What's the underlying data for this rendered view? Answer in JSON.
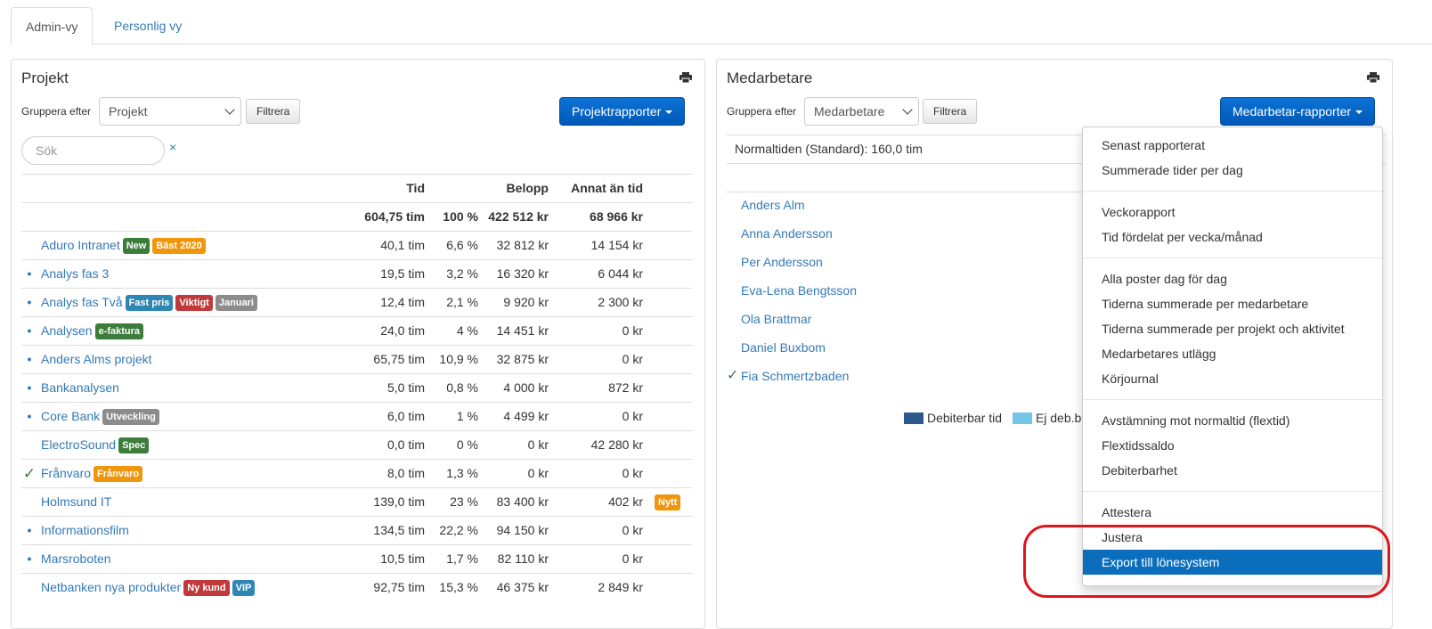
{
  "tabs": {
    "admin": "Admin-vy",
    "personal": "Personlig vy"
  },
  "colors": {
    "link": "#337ab7",
    "primary": "#0b63c8",
    "label_green": "#3c7d3c",
    "label_orange": "#f0960c",
    "label_red": "#c0393b",
    "label_blue": "#2e86b5",
    "label_gray": "#8c8c8c",
    "legend_dark": "#2c5a8f",
    "legend_light": "#74c6e6",
    "highlight": "#e0141d"
  },
  "projekt": {
    "title": "Projekt",
    "print_icon": "print-icon",
    "group_label": "Gruppera efter",
    "group_select": "Projekt",
    "filter_button": "Filtrera",
    "reports_button": "Projektrapporter",
    "search_placeholder": "Sök",
    "search_clear": "×",
    "headers": {
      "tid": "Tid",
      "belopp": "Belopp",
      "annat": "Annat än tid"
    },
    "totals": {
      "tid": "604,75 tim",
      "pct": "100 %",
      "belopp": "422 512 kr",
      "annat": "68 966 kr"
    },
    "rows": [
      {
        "marker": "",
        "name": "Aduro Intranet",
        "labels": [
          {
            "text": "New",
            "color": "green"
          },
          {
            "text": "Bäst 2020",
            "color": "orange"
          }
        ],
        "tid": "40,1 tim",
        "pct": "6,6 %",
        "belopp": "32 812 kr",
        "annat": "14 154 kr"
      },
      {
        "marker": "•",
        "name": "Analys fas 3",
        "labels": [],
        "tid": "19,5 tim",
        "pct": "3,2 %",
        "belopp": "16 320 kr",
        "annat": "6 044 kr"
      },
      {
        "marker": "•",
        "name": "Analys fas Två",
        "labels": [
          {
            "text": "Fast pris",
            "color": "blue"
          },
          {
            "text": "Viktigt",
            "color": "red"
          },
          {
            "text": "Januari",
            "color": "gray"
          }
        ],
        "tid": "12,4 tim",
        "pct": "2,1 %",
        "belopp": "9 920 kr",
        "annat": "2 300 kr"
      },
      {
        "marker": "•",
        "name": "Analysen",
        "labels": [
          {
            "text": "e-faktura",
            "color": "green"
          }
        ],
        "tid": "24,0 tim",
        "pct": "4 %",
        "belopp": "14 451 kr",
        "annat": "0 kr"
      },
      {
        "marker": "•",
        "name": "Anders Alms projekt",
        "labels": [],
        "tid": "65,75 tim",
        "pct": "10,9 %",
        "belopp": "32 875 kr",
        "annat": "0 kr"
      },
      {
        "marker": "•",
        "name": "Bankanalysen",
        "labels": [],
        "tid": "5,0 tim",
        "pct": "0,8 %",
        "belopp": "4 000 kr",
        "annat": "872 kr"
      },
      {
        "marker": "•",
        "name": "Core Bank",
        "labels": [
          {
            "text": "Utveckling",
            "color": "gray"
          }
        ],
        "tid": "6,0 tim",
        "pct": "1 %",
        "belopp": "4 499 kr",
        "annat": "0 kr"
      },
      {
        "marker": "",
        "name": "ElectroSound",
        "labels": [
          {
            "text": "Spec",
            "color": "green"
          }
        ],
        "tid": "0,0 tim",
        "pct": "0 %",
        "belopp": "0 kr",
        "annat": "42 280 kr"
      },
      {
        "marker": "✓",
        "name": "Frånvaro",
        "labels": [
          {
            "text": "Frånvaro",
            "color": "orange"
          }
        ],
        "tid": "8,0 tim",
        "pct": "1,3 %",
        "belopp": "0 kr",
        "annat": "0 kr"
      },
      {
        "marker": "",
        "name": "Holmsund IT",
        "labels": [],
        "tid": "139,0 tim",
        "pct": "23 %",
        "belopp": "83 400 kr",
        "annat": "402 kr",
        "extra": {
          "text": "Nytt",
          "color": "orange"
        }
      },
      {
        "marker": "•",
        "name": "Informationsfilm",
        "labels": [],
        "tid": "134,5 tim",
        "pct": "22,2 %",
        "belopp": "94 150 kr",
        "annat": "0 kr"
      },
      {
        "marker": "•",
        "name": "Marsroboten",
        "labels": [],
        "tid": "10,5 tim",
        "pct": "1,7 %",
        "belopp": "82 110 kr",
        "annat": "0 kr"
      },
      {
        "marker": "",
        "name": "Netbanken nya produkter",
        "labels": [
          {
            "text": "Ny kund",
            "color": "red"
          },
          {
            "text": "VIP",
            "color": "blue"
          }
        ],
        "tid": "92,75 tim",
        "pct": "15,3 %",
        "belopp": "46 375 kr",
        "annat": "2 849 kr"
      }
    ]
  },
  "medarbetare": {
    "title": "Medarbetare",
    "print_icon": "print-icon",
    "group_label": "Gruppera efter",
    "group_select": "Medarbetare",
    "filter_button": "Filtrera",
    "reports_button": "Medarbetar-rapporter",
    "normaltid": "Normaltiden (Standard): 160,0 tim",
    "people": [
      {
        "name": "Anders Alm",
        "check": ""
      },
      {
        "name": "Anna Andersson",
        "check": ""
      },
      {
        "name": "Per Andersson",
        "check": ""
      },
      {
        "name": "Eva-Lena Bengtsson",
        "check": ""
      },
      {
        "name": "Ola Brattmar",
        "check": ""
      },
      {
        "name": "Daniel Buxbom",
        "check": ""
      },
      {
        "name": "Fia Schmertzbaden",
        "check": "✓"
      }
    ],
    "legend": {
      "debiterbar": "Debiterbar tid",
      "ej_deb": "Ej deb.b"
    }
  },
  "dropdown": {
    "groups": [
      [
        "Senast rapporterat",
        "Summerade tider per dag"
      ],
      [
        "Veckorapport",
        "Tid fördelat per vecka/månad"
      ],
      [
        "Alla poster dag för dag",
        "Tiderna summerade per medarbetare",
        "Tiderna summerade per projekt och aktivitet",
        "Medarbetares utlägg",
        "Körjournal"
      ],
      [
        "Avstämning mot normaltid (flextid)",
        "Flextidssaldo",
        "Debiterbarhet"
      ],
      [
        "Attestera",
        "Justera",
        "Export till lönesystem"
      ]
    ],
    "active_item": "Export till lönesystem"
  }
}
